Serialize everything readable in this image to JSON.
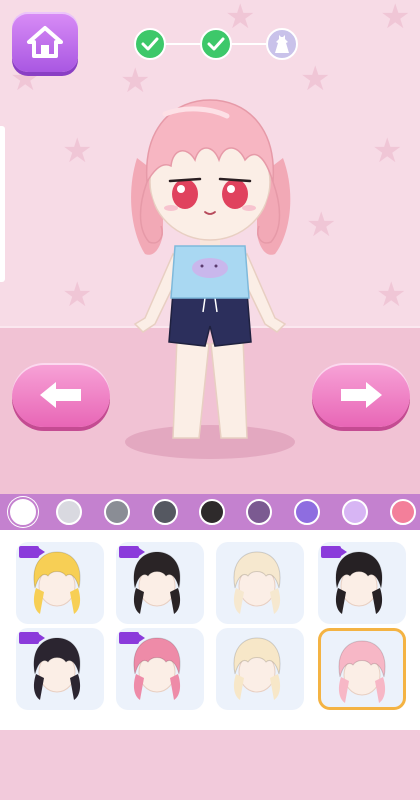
{
  "navigation": {
    "home_icon": "home-icon",
    "steps": [
      {
        "name": "step-1",
        "status": "completed",
        "icon": "check-icon"
      },
      {
        "name": "step-2",
        "status": "completed",
        "icon": "check-icon"
      },
      {
        "name": "step-3",
        "status": "current",
        "icon": "dress-icon"
      }
    ]
  },
  "controls": {
    "prev_icon": "arrow-left-icon",
    "next_icon": "arrow-right-icon"
  },
  "palette": {
    "colors": [
      "#ffffff",
      "#d9d9e0",
      "#8a8d95",
      "#555861",
      "#2e2a2b",
      "#7b5a91",
      "#8e6de0",
      "#d7b5f4",
      "#f37f9a"
    ],
    "selected_index": 0
  },
  "hairstyles": [
    {
      "name": "blonde-twin-tails",
      "color": "#f7cf55",
      "video_locked": true,
      "selected": false
    },
    {
      "name": "black-braids",
      "color": "#2a2426",
      "video_locked": true,
      "selected": false
    },
    {
      "name": "pastel-rainbow-waves",
      "color": "#f6e8cf",
      "video_locked": false,
      "selected": false
    },
    {
      "name": "black-red-long",
      "color": "#262124",
      "video_locked": true,
      "selected": false
    },
    {
      "name": "black-purple-bob",
      "color": "#2b2530",
      "video_locked": true,
      "selected": false
    },
    {
      "name": "pink-curly-pigtails",
      "color": "#ee8ba8",
      "video_locked": true,
      "selected": false
    },
    {
      "name": "cream-braid",
      "color": "#f7e7c8",
      "video_locked": false,
      "selected": false
    },
    {
      "name": "pink-short-wavy",
      "color": "#f7b7c6",
      "video_locked": false,
      "selected": true
    }
  ]
}
